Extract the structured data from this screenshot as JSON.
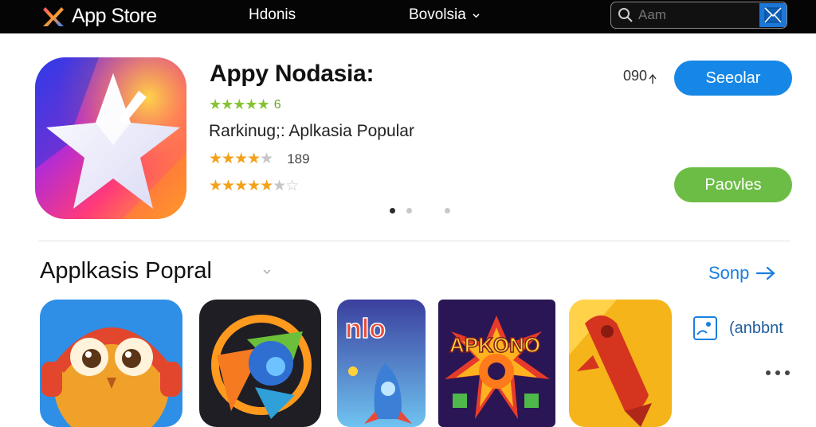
{
  "topbar": {
    "brand": "App Store",
    "nav": [
      "Hdonis",
      "Bovolsia"
    ],
    "search": {
      "placeholder": "Aam"
    }
  },
  "featured": {
    "title": "Appy Nodasia:",
    "stars_green_count": "6",
    "ranking": "Rarkinug;: Aplkasia Popular",
    "rating_count": "189",
    "share_label": "090",
    "primary_button": "Seeolar",
    "secondary_button": "Paovles",
    "carousel_active_index": 0
  },
  "section": {
    "title": "Applkasis Popral",
    "see_all": "Sonp",
    "side_item_label": "(anbbnt"
  },
  "colors": {
    "accent_blue": "#1687e6",
    "accent_green": "#6cbd45",
    "topbar_bg": "#050505",
    "star_orange": "#f2a21a"
  }
}
